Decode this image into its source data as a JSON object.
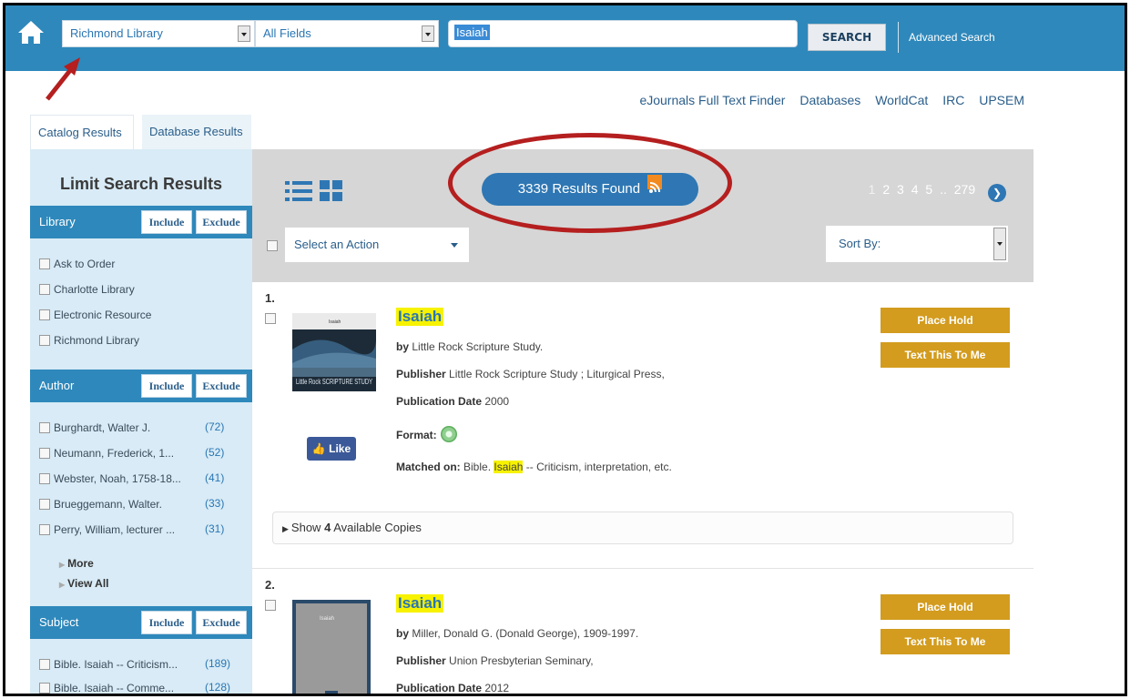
{
  "header": {
    "library_select": "Richmond Library",
    "field_select": "All Fields",
    "search_value": "Isaiah",
    "search_button": "SEARCH",
    "advanced_link": "Advanced Search"
  },
  "top_links": [
    "eJournals Full Text Finder",
    "Databases",
    "WorldCat",
    "IRC",
    "UPSEM"
  ],
  "tabs": [
    "Catalog Results",
    "Database Results"
  ],
  "sidebar": {
    "title": "Limit Search Results",
    "include_label": "Include",
    "exclude_label": "Exclude",
    "library": {
      "heading": "Library",
      "items": [
        "Ask to Order",
        "Charlotte Library",
        "Electronic Resource",
        "Richmond Library"
      ]
    },
    "author": {
      "heading": "Author",
      "items": [
        {
          "label": "Burghardt, Walter J.",
          "count": "(72)"
        },
        {
          "label": "Neumann, Frederick, 1...",
          "count": "(52)"
        },
        {
          "label": "Webster, Noah, 1758-18...",
          "count": "(41)"
        },
        {
          "label": "Brueggemann, Walter.",
          "count": "(33)"
        },
        {
          "label": "Perry, William, lecturer ...",
          "count": "(31)"
        }
      ],
      "more": "More",
      "view_all": "View All"
    },
    "subject": {
      "heading": "Subject",
      "items": [
        {
          "label": "Bible. Isaiah -- Criticism...",
          "count": "(189)"
        },
        {
          "label": "Bible. Isaiah -- Comme...",
          "count": "(128)"
        }
      ]
    }
  },
  "results_header": {
    "results_found": "3339 Results Found",
    "pages": [
      "1",
      "2",
      "3",
      "4",
      "5"
    ],
    "ellipsis": "..",
    "last_page": "279",
    "action_select": "Select an Action",
    "sort_select": "Sort By:"
  },
  "results": [
    {
      "number": "1.",
      "title": "Isaiah",
      "by_label": "by",
      "author": "Little Rock Scripture Study.",
      "publisher_label": "Publisher",
      "publisher": "Little Rock Scripture Study ; Liturgical Press,",
      "pubdate_label": "Publication Date",
      "pubdate": "2000",
      "format_label": "Format:",
      "matched_label": "Matched on:",
      "matched_pre": "Bible.",
      "matched_hl": "Isaiah",
      "matched_post": "-- Criticism, interpretation, etc.",
      "like": "Like",
      "copies_pre": "Show",
      "copies_count": "4",
      "copies_post": "Available Copies",
      "place_hold": "Place Hold",
      "text_me": "Text This To Me",
      "cover_title": "Isaiah",
      "cover_text": "Little Rock SCRIPTURE STUDY"
    },
    {
      "number": "2.",
      "title": "Isaiah",
      "by_label": "by",
      "author": "Miller, Donald G. (Donald George), 1909-1997.",
      "publisher_label": "Publisher",
      "publisher": "Union Presbyterian Seminary,",
      "pubdate_label": "Publication Date",
      "pubdate": "2012",
      "place_hold": "Place Hold",
      "text_me": "Text This To Me",
      "cover_title": "Isaiah"
    }
  ],
  "colors": {
    "topbar": "#2e88bb",
    "sidebar": "#d8ebf6",
    "gold_button": "#d39c1e",
    "highlight": "#f7f200",
    "annotation_red": "#b51f1f"
  }
}
